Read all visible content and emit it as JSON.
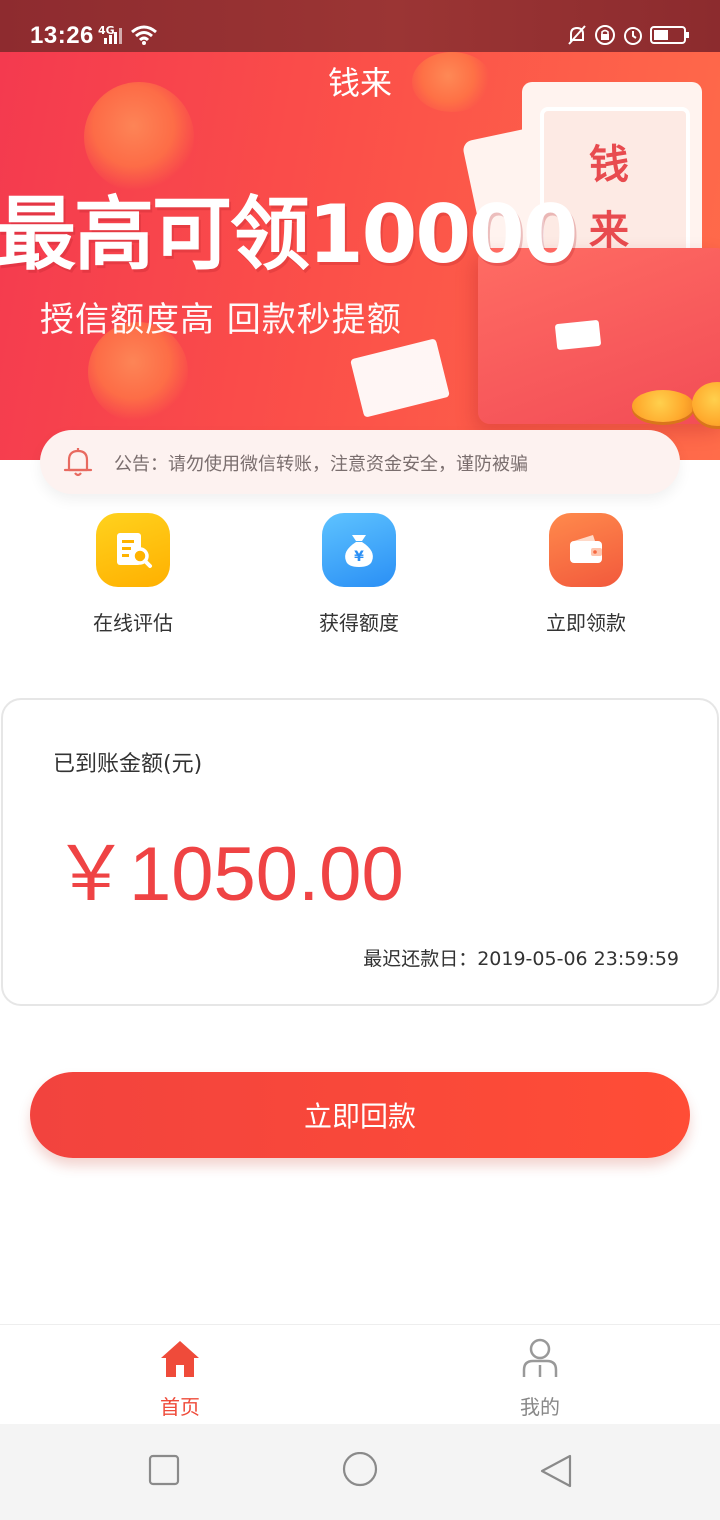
{
  "status_bar": {
    "time": "13:26",
    "network": "4G"
  },
  "banner": {
    "app_title": "钱来",
    "headline": "最高可领10000",
    "subheadline": "授信额度高  回款秒提额",
    "ticket_text_1": "钱",
    "ticket_text_2": "来"
  },
  "announcement": {
    "icon": "bell-icon",
    "text": "公告：请勿使用微信转账，注意资金安全，谨防被骗"
  },
  "features": [
    {
      "label": "在线评估",
      "icon": "document-search-icon",
      "color": "#ffc107"
    },
    {
      "label": "获得额度",
      "icon": "money-bag-icon",
      "color": "#3aa4f8"
    },
    {
      "label": "立即领款",
      "icon": "wallet-icon",
      "color": "#f6683f"
    }
  ],
  "amount_card": {
    "label": "已到账金额(元)",
    "amount": "￥1050.00",
    "due_date": "最迟还款日：2019-05-06 23:59:59"
  },
  "repay_button": {
    "label": "立即回款"
  },
  "tabbar": {
    "home_label": "首页",
    "mine_label": "我的",
    "active_color": "#ef4b3a"
  },
  "colors": {
    "accent": "#f2433e",
    "amount": "#ef4344"
  }
}
